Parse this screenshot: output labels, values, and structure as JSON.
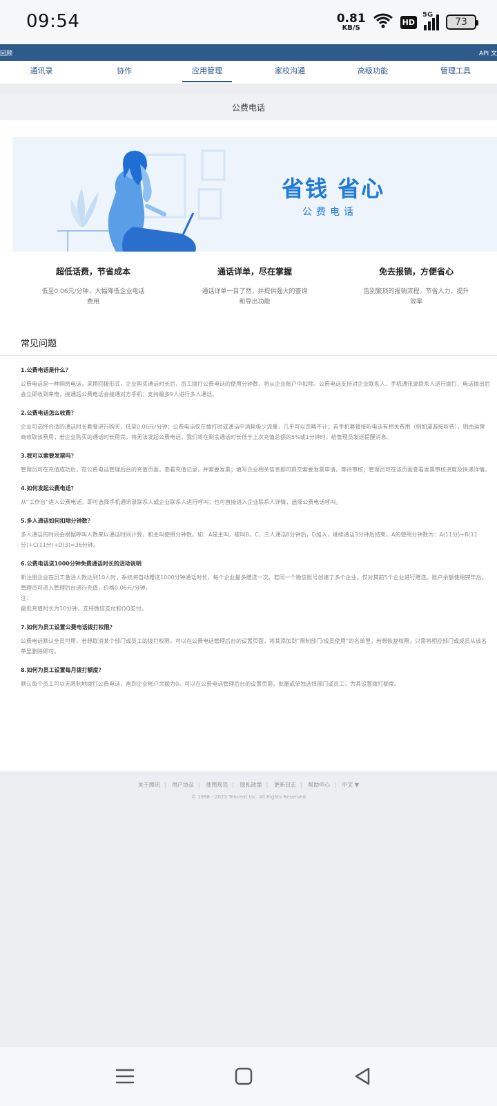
{
  "status_bar": {
    "time": "09:54",
    "net_speed": "0.81",
    "net_unit": "KB/S",
    "hd": "HD",
    "network": "5G",
    "battery": "73"
  },
  "top_bar": {
    "left_fragment": "回顾",
    "right_fragment": "API 文"
  },
  "nav": {
    "items": [
      {
        "label": "通讯录"
      },
      {
        "label": "协作"
      },
      {
        "label": "应用管理"
      },
      {
        "label": "家校沟通"
      },
      {
        "label": "高级功能"
      },
      {
        "label": "管理工具"
      }
    ],
    "active_index": 2
  },
  "page_title": "公费电话",
  "banner": {
    "title": "省钱 省心",
    "subtitle": "公费电话"
  },
  "features": [
    {
      "title": "超低话费，节省成本",
      "desc": "低至0.06元/分钟，大幅降低企业电话费用"
    },
    {
      "title": "通话详单，尽在掌握",
      "desc": "通话详单一目了然，并提供强大的查询和导出功能"
    },
    {
      "title": "免去报销，方便省心",
      "desc": "告别繁琐的报销流程，节省人力，提升效率"
    }
  ],
  "faq": {
    "heading": "常见问题",
    "items": [
      {
        "q": "1.公费电话是什么？",
        "a": "公费电话是一种网络电话，采用回拨形式，企业购买通话时长后，员工拨打公费电话的使用分钟数，将从企业账户中扣除。公费电话支持对企业联系人、手机通讯录联系人进行拨打，电话拨出后会立即收到来电，接通后公费电话会接通对方手机；支持最多9人进行多人通话。"
      },
      {
        "q": "2.公费电话怎么收费？",
        "a": "企业可选择合适的通话时长套餐进行购买，低至0.06元/分钟；公费电话仅在拨打时或通话中消耗极少流量，几乎可以忽略不计；若手机套餐接听电话有相关费用（例如漫游接听费），则由运营商收取该费用；若企业购买的通话时长用完，将无法发起公费电话，我们将在剩余通话时长低于上次充值总额的5%或1分钟时，给管理员发送提醒消息。"
      },
      {
        "q": "3.我可以索要发票吗？",
        "a": "管理员可在充值成功后，在公费电话管理后台的充值页面，查看充值记录，并索要发票；填写企业相关信息即可提交索要发票申请，等待审核；管理员可在该页面查看发票审核进度及快递详情。"
      },
      {
        "q": "4.如何发起公费电话？",
        "a": "从“工作台”进入公费电话，即可选择手机通讯录联系人或企业联系人进行呼叫；也可直接进入企业联系人详情，选择公费电话呼叫。"
      },
      {
        "q": "5.多人通话如何扣除分钟数？",
        "a": "多人通话的时间会根据呼叫人数来以通话时间计算，和主叫使用分钟数。如：A是主叫，被叫B、C，三人通话8分钟后，D加入，继续通话3分钟后结束，A的使用分钟数为：A(11分)+B(11分)+C(11分)+D(3)=36分钟。"
      },
      {
        "q": "6.公费电话送1000分钟免费通话时长的活动说明",
        "a": "新注册企业在员工激活人数达到10人时，系统将自动赠送1000分钟通话时长，每个企业最多赠送一次。若同一个微信账号创建了多个企业，仅对其前5个企业进行赠送。账户余额使用完毕后，管理员可进入管理后台进行充值，价格0.06元/分钟。\n注：\n最低充值时长为10分钟，支持微信支付和QQ支付。"
      },
      {
        "q": "7.如何为员工设置公费电话拨打权限？",
        "a": "公费电话默认全员可用，若想取消某个部门或员工的拨打权限，可以在公费电话管理后台的设置页面，将其添加到“限制部门/成员使用”的名单里，若想恢复权限，只需将相应部门或成员从该名单里删除即可。"
      },
      {
        "q": "8.如何为员工设置每月拨打额度？",
        "a": "默认每个员工可以无限制地拨打公费电话，直到企业帐户余额为0。可以在公费电话管理后台的设置页面，批量或单独选择部门或员工，为其设置拨打额度。"
      }
    ]
  },
  "footer": {
    "links": [
      "关于腾讯",
      "用户协议",
      "使用规范",
      "隐私政策",
      "更新日志",
      "帮助中心",
      "中文 ▼"
    ],
    "copyright": "© 1998 - 2023 Tencent Inc. All Rights Reserved"
  },
  "colors": {
    "brand_blue": "#2e5a8c",
    "banner_blue": "#1f7ad8"
  },
  "system_nav": {
    "icons": [
      "menu-icon",
      "home-square-icon",
      "back-triangle-icon"
    ]
  }
}
